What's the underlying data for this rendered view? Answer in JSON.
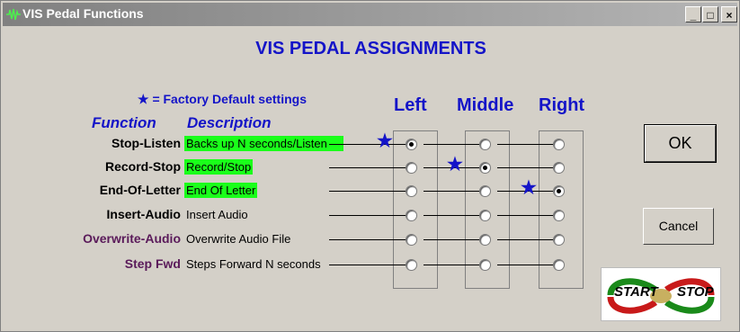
{
  "window": {
    "title": "VIS Pedal Functions",
    "min": "_",
    "max": "□",
    "close": "×"
  },
  "heading": "VIS PEDAL ASSIGNMENTS",
  "legend": "★ = Factory Default settings",
  "columns": {
    "left": "Left",
    "middle": "Middle",
    "right": "Right"
  },
  "subheaders": {
    "function": "Function",
    "description": "Description"
  },
  "rows": [
    {
      "function": "Stop-Listen",
      "description": "Backs up N seconds/Listen —",
      "highlight": true,
      "default": "left",
      "selected": "left"
    },
    {
      "function": "Record-Stop",
      "description": "Record/Stop",
      "highlight": true,
      "default": "middle",
      "selected": "middle"
    },
    {
      "function": "End-Of-Letter",
      "description": "End Of Letter",
      "highlight": true,
      "default": "right",
      "selected": "right"
    },
    {
      "function": "Insert-Audio",
      "description": "Insert Audio",
      "highlight": false,
      "default": "",
      "selected": ""
    },
    {
      "function": "Overwrite-Audio",
      "description": "Overwrite Audio File",
      "highlight": false,
      "default": "",
      "selected": ""
    },
    {
      "function": "Step Fwd",
      "description": "Steps Forward N seconds",
      "highlight": false,
      "default": "",
      "selected": ""
    }
  ],
  "buttons": {
    "ok": "OK",
    "cancel": "Cancel"
  },
  "logo": {
    "text_left": "START",
    "text_right": "STOP"
  }
}
